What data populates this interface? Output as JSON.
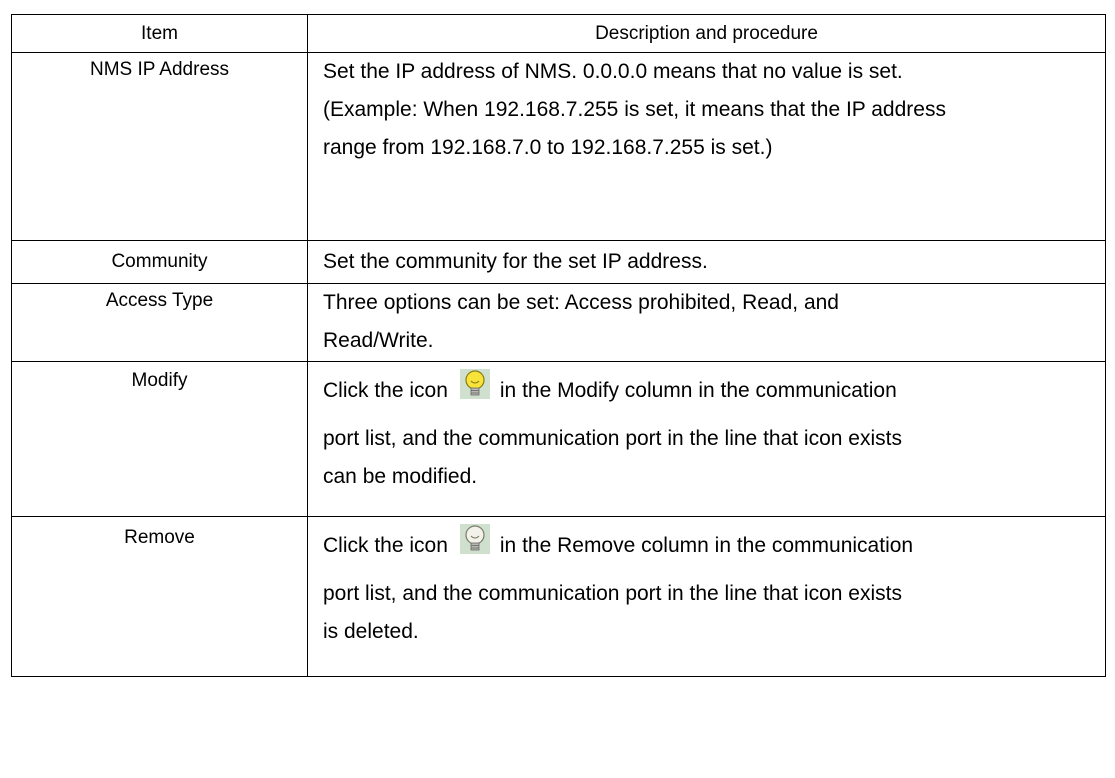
{
  "table": {
    "header": {
      "item": "Item",
      "description": "Description and procedure"
    },
    "rows": [
      {
        "item": "NMS IP Address",
        "lines": [
          "Set the IP address of NMS. 0.0.0.0 means that no value is set.",
          "(Example: When 192.168.7.255 is set, it means that the IP address",
          "range from 192.168.7.0 to 192.168.7.255 is set.)"
        ]
      },
      {
        "item": "Community",
        "lines": [
          "Set the community for the set IP address."
        ]
      },
      {
        "item": "Access Type",
        "lines": [
          "Three options can be set: Access prohibited, Read, and",
          "Read/Write."
        ]
      },
      {
        "item": "Modify",
        "line1_before_icon": "Click the icon",
        "line1_after_icon": "in the Modify column in the communication",
        "lines": [
          "port list, and the communication port in the line that icon exists",
          "can be modified."
        ],
        "icon": "lightbulb-on-icon"
      },
      {
        "item": "Remove",
        "line1_before_icon": "Click the icon",
        "line1_after_icon": "in the Remove column in the communication",
        "lines": [
          "port list, and the communication port in the line that icon exists",
          "is deleted."
        ],
        "icon": "lightbulb-off-icon"
      }
    ]
  },
  "colors": {
    "border": "#000000",
    "bulb_on": "#f7e33a",
    "bulb_off": "#f2f2ea",
    "icon_bg": "#cfe0cf"
  }
}
